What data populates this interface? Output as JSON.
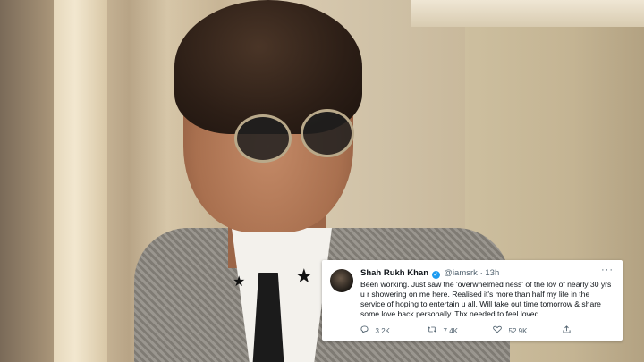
{
  "tweet": {
    "name": "Shah Rukh Khan",
    "handle": "@iamsrk",
    "separator": "·",
    "time": "13h",
    "more": "···",
    "text": "Been working. Just saw the 'overwhelmed ness' of the lov of nearly 30 yrs u r showering on me here. Realised it's more than half my life in the service of hoping to entertain u all. Will take out time tomorrow & share some love back personally. Thx needed to feel loved....",
    "reply_count": "3.2K",
    "retweet_count": "7.4K",
    "like_count": "52.9K",
    "icons": {
      "reply": "reply-icon",
      "retweet": "retweet-icon",
      "like": "heart-icon",
      "share": "share-icon",
      "verified": "verified-badge-icon"
    },
    "colors": {
      "verified": "#1d9bf0",
      "text": "#0f1419",
      "muted": "#536471"
    }
  }
}
